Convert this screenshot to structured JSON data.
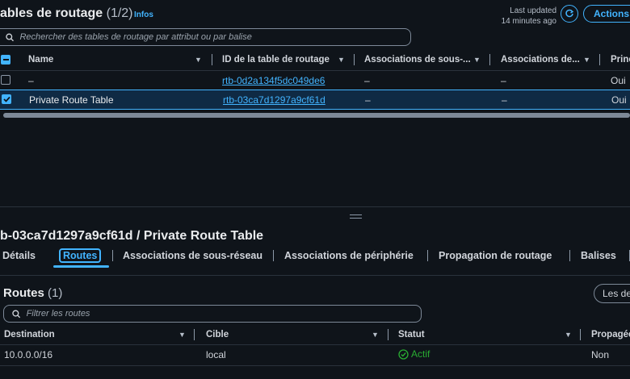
{
  "top": {
    "title": "ables de routage",
    "count": "(1/2)",
    "info": "Infos",
    "last_updated_label": "Last updated",
    "last_updated_value": "14 minutes ago",
    "actions_label": "Actions",
    "search_placeholder": "Rechercher des tables de routage par attribut ou par balise",
    "columns": [
      "Name",
      "ID de la table de routage",
      "Associations de sous-...",
      "Associations de...",
      "Princ"
    ],
    "rows": [
      {
        "name": "–",
        "id": "rtb-0d2a134f5dc049de6",
        "assoc_subnet": "–",
        "assoc_edge": "–",
        "main": "Oui"
      },
      {
        "name": "Private Route Table",
        "id": "rtb-03ca7d1297a9cf61d",
        "assoc_subnet": "–",
        "assoc_edge": "–",
        "main": "Oui"
      }
    ]
  },
  "detail": {
    "title": "b-03ca7d1297a9cf61d / Private Route Table",
    "tabs": [
      "Détails",
      "Routes",
      "Associations de sous-réseau",
      "Associations de périphérie",
      "Propagation de routage",
      "Balises"
    ],
    "routes": {
      "title": "Routes",
      "count": "(1)",
      "button_label": "Les de",
      "filter_placeholder": "Filtrer les routes",
      "columns": [
        "Destination",
        "Cible",
        "Statut",
        "Propagée"
      ],
      "rows": [
        {
          "destination": "10.0.0.0/16",
          "target": "local",
          "status": "Actif",
          "propagated": "Non"
        }
      ]
    }
  },
  "colors": {
    "accent": "#42b4ff",
    "success": "#29ad32",
    "background": "#0f141a"
  }
}
